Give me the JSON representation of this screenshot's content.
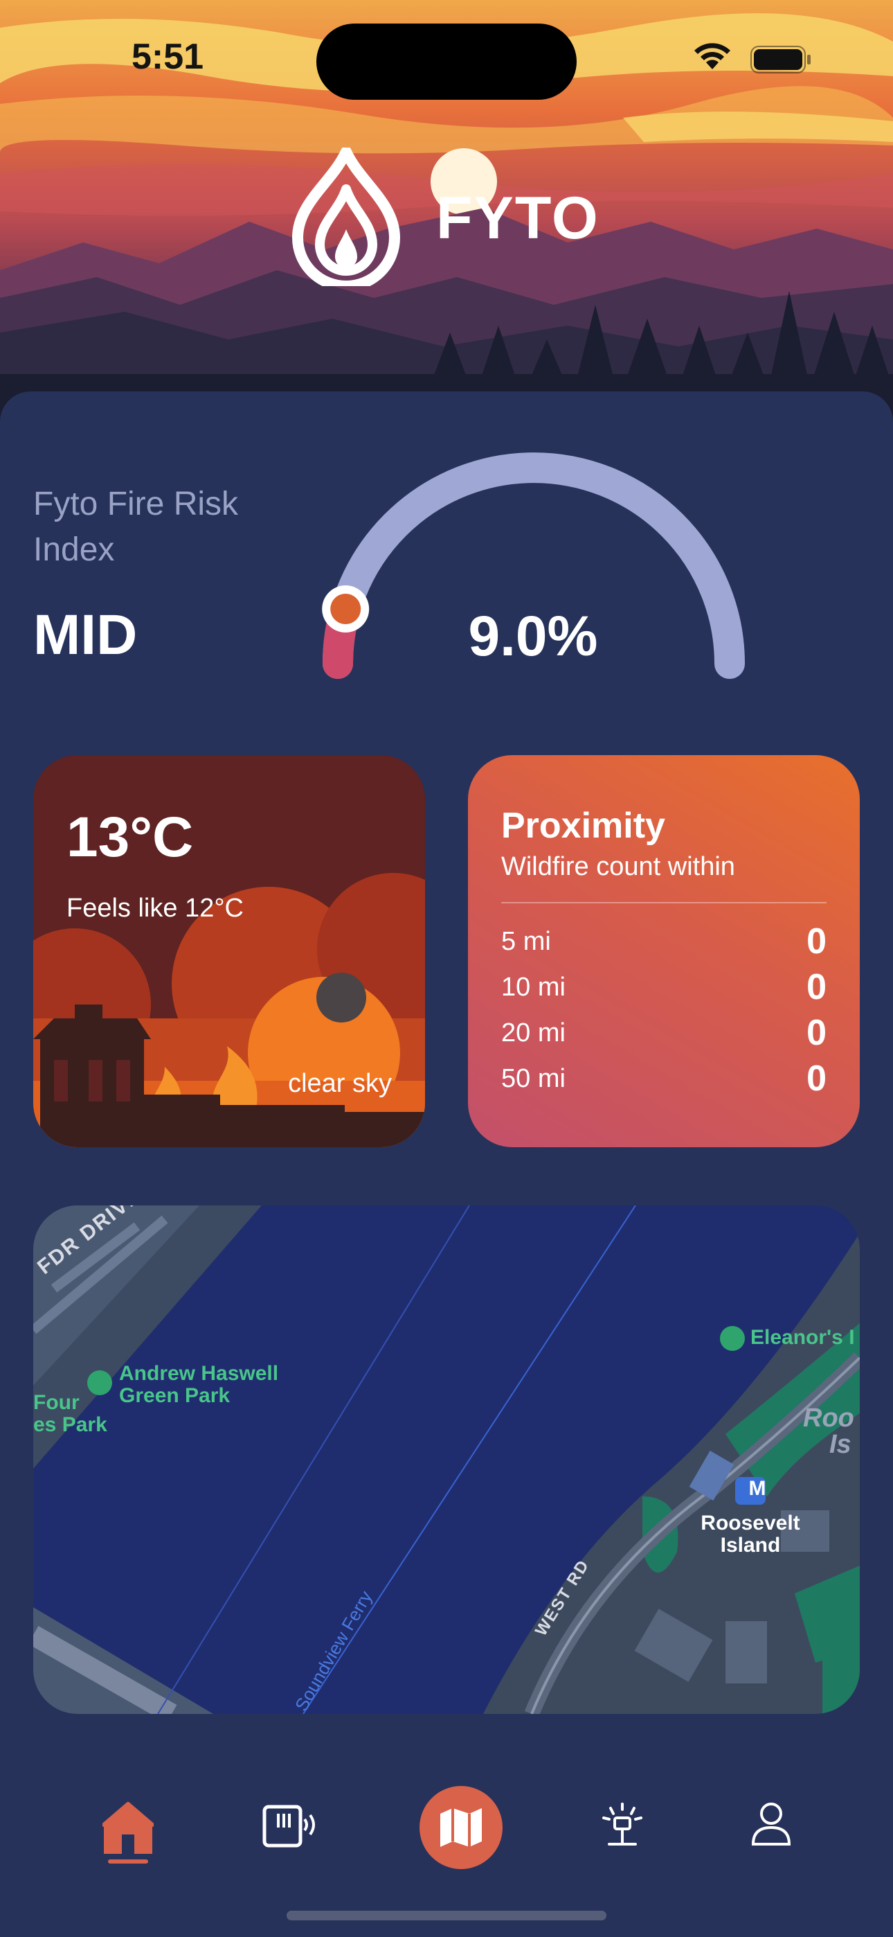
{
  "status_bar": {
    "time": "5:51"
  },
  "brand": {
    "name": "FYTO",
    "logo_icon": "flame-logo-icon"
  },
  "risk": {
    "label": "Fyto Fire Risk Index",
    "level": "MID",
    "percent_text": "9.0%",
    "percent_value": 9.0,
    "gauge_color": "#9fa8d4",
    "indicator_color": "#d9622f"
  },
  "weather": {
    "temperature": "13°C",
    "feels_like": "Feels like 12°C",
    "description": "clear sky"
  },
  "proximity": {
    "title": "Proximity",
    "subtitle": "Wildfire count within",
    "rows": [
      {
        "distance": "5 mi",
        "count": "0"
      },
      {
        "distance": "10 mi",
        "count": "0"
      },
      {
        "distance": "20 mi",
        "count": "0"
      },
      {
        "distance": "50 mi",
        "count": "0"
      }
    ]
  },
  "map": {
    "labels": {
      "fdr": "FDR DRIVE N",
      "park": "Andrew Haswell",
      "park2": "Green Park",
      "four": "Four",
      "four2": "es Park",
      "eleanor": "Eleanor's I",
      "roosevelt": "Roosevelt",
      "roosevelt2": "Island",
      "roo": "Roo",
      "is": "Is",
      "metro": "M",
      "west_rd": "WEST RD",
      "ferry": "Soundview Ferry"
    }
  },
  "tabs": [
    {
      "name": "home",
      "icon": "home-icon",
      "active": true
    },
    {
      "name": "sensor",
      "icon": "sensor-device-icon"
    },
    {
      "name": "map",
      "icon": "map-icon"
    },
    {
      "name": "sprinkler",
      "icon": "sprinkler-icon"
    },
    {
      "name": "profile",
      "icon": "person-icon"
    }
  ],
  "colors": {
    "background": "#26325a",
    "accent": "#d9622f",
    "active_tab": "#d9624a"
  }
}
